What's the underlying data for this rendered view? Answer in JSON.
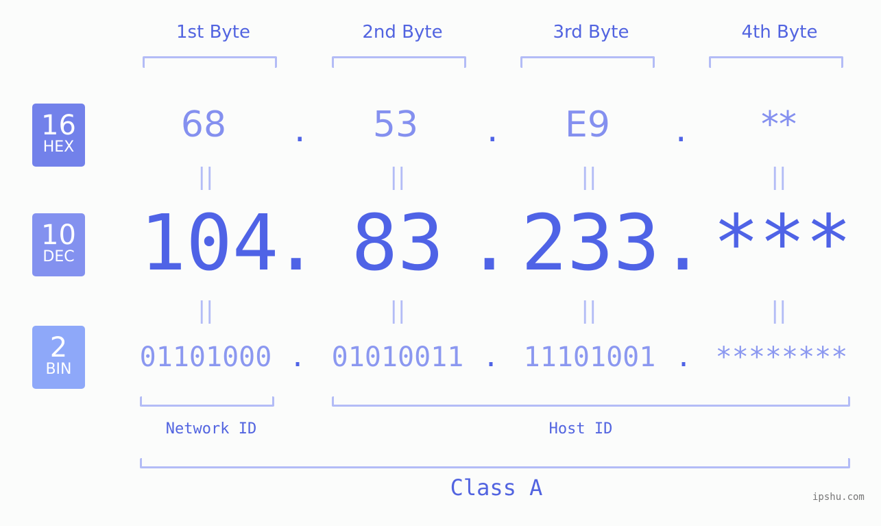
{
  "bytes_header": [
    "1st Byte",
    "2nd Byte",
    "3rd Byte",
    "4th Byte"
  ],
  "badges": {
    "hex": {
      "num": "16",
      "label": "HEX",
      "color": "#7281ea"
    },
    "dec": {
      "num": "10",
      "label": "DEC",
      "color": "#8391ef"
    },
    "bin": {
      "num": "2",
      "label": "BIN",
      "color": "#8ea8f9"
    }
  },
  "hex": [
    "68",
    "53",
    "E9",
    "**"
  ],
  "dec": [
    "104",
    "83",
    "233",
    "***"
  ],
  "bin": [
    "01101000",
    "01010011",
    "11101001",
    "********"
  ],
  "separator": ".",
  "equals": "=",
  "network_label": "Network ID",
  "host_label": "Host ID",
  "class_label": "Class A",
  "watermark": "ipshu.com"
}
